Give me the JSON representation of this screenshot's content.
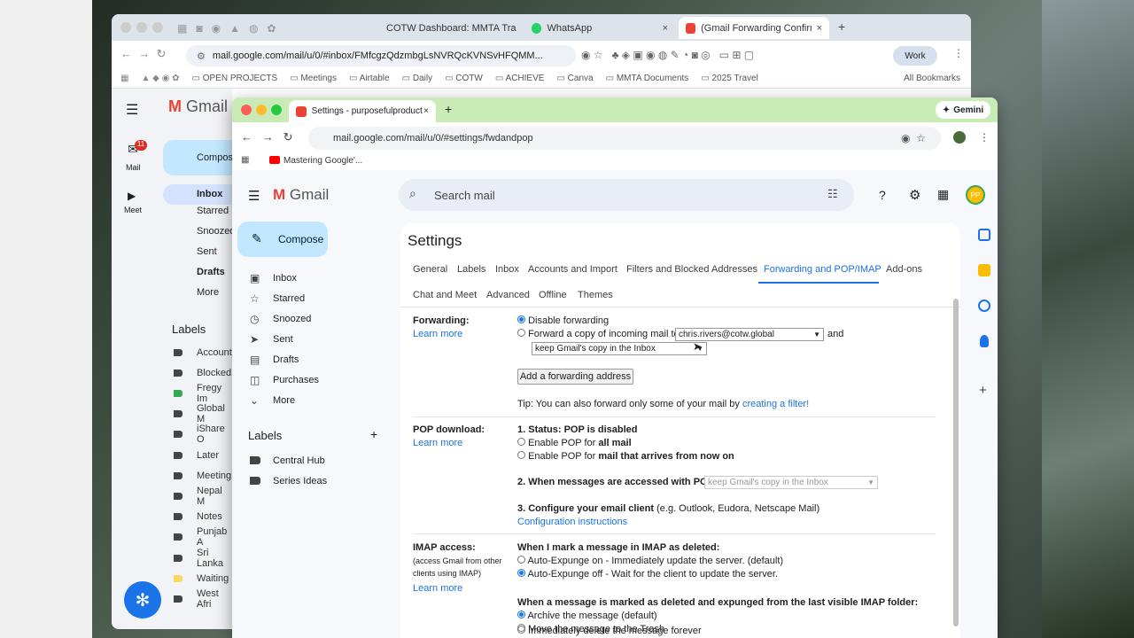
{
  "back_window": {
    "tabs": [
      "COTW Dashboard: MMTA Tra",
      "WhatsApp",
      "(Gmail Forwarding Confirmati"
    ],
    "url": "mail.google.com/mail/u/0/#inbox/FMfcgzQdzmbgLsNVRQcKVNSvHFQMM...",
    "profile": "Work",
    "bookmarks": [
      "OPEN PROJECTS",
      "Meetings",
      "Airtable",
      "Daily",
      "COTW",
      "ACHIEVE",
      "Canva",
      "MMTA Documents",
      "2025 Travel"
    ],
    "all_bookmarks": "All Bookmarks",
    "gmail_logo": "Gmail",
    "compose": "Compose",
    "rail": {
      "mail": "Mail",
      "mail_badge": "11",
      "meet": "Meet"
    },
    "nav": [
      "Inbox",
      "Starred",
      "Snoozed",
      "Sent",
      "Drafts",
      "More"
    ],
    "labels_title": "Labels",
    "labels": [
      "Account",
      "Blocked",
      "Fregy Im",
      "Global M",
      "iShare O",
      "Later",
      "Meeting",
      "Nepal M",
      "Notes",
      "Punjab A",
      "Sri Lanka",
      "Waiting",
      "West Afri"
    ]
  },
  "front_window": {
    "tab": "Settings - purposefulproduct",
    "gemini": "Gemini",
    "url": "mail.google.com/mail/u/0/#settings/fwdandpop",
    "bookmark": "Mastering Google'...",
    "gmail_logo": "Gmail",
    "search_placeholder": "Search mail",
    "avatar": "PP",
    "compose": "Compose",
    "nav": [
      "Inbox",
      "Starred",
      "Snoozed",
      "Sent",
      "Drafts",
      "Purchases",
      "More"
    ],
    "labels_title": "Labels",
    "labels": [
      "Central Hub",
      "Series Ideas"
    ]
  },
  "settings": {
    "title": "Settings",
    "tabs": [
      "General",
      "Labels",
      "Inbox",
      "Accounts and Import",
      "Filters and Blocked Addresses",
      "Forwarding and POP/IMAP",
      "Add-ons",
      "Chat and Meet",
      "Advanced",
      "Offline",
      "Themes"
    ],
    "active_tab": "Forwarding and POP/IMAP",
    "learn_more": "Learn more",
    "forwarding": {
      "label": "Forwarding:",
      "disable": "Disable forwarding",
      "forward_copy": "Forward a copy of incoming mail to",
      "address": "chris.rivers@cotw.global",
      "and": "and",
      "keep": "keep Gmail's copy in the Inbox",
      "add_button": "Add a forwarding address",
      "tip": "Tip: You can also forward only some of your mail by",
      "tip_link": "creating a filter!"
    },
    "pop": {
      "label": "POP download:",
      "status": "1. Status: POP is disabled",
      "all_prefix": "Enable POP for",
      "all_bold": "all mail",
      "now_prefix": "Enable POP for",
      "now_bold": "mail that arrives from now on",
      "accessed": "2. When messages are accessed with POP",
      "accessed_value": "keep Gmail's copy in the Inbox",
      "configure_bold": "3. Configure your email client",
      "configure_rest": "(e.g. Outlook, Eudora, Netscape Mail)",
      "instructions": "Configuration instructions"
    },
    "imap": {
      "label": "IMAP access:",
      "sub": [
        "(access Gmail from other",
        "clients using IMAP)"
      ],
      "deleted_title": "When I mark a message in IMAP as deleted:",
      "expunge_on": "Auto-Expunge on - Immediately update the server. (default)",
      "expunge_off": "Auto-Expunge off - Wait for the client to update the server.",
      "expunged_title": "When a message is marked as deleted and expunged from the last visible IMAP folder:",
      "archive": "Archive the message (default)",
      "trash": "Move the message to the Trash",
      "delete": "Immediately delete the message forever"
    }
  }
}
